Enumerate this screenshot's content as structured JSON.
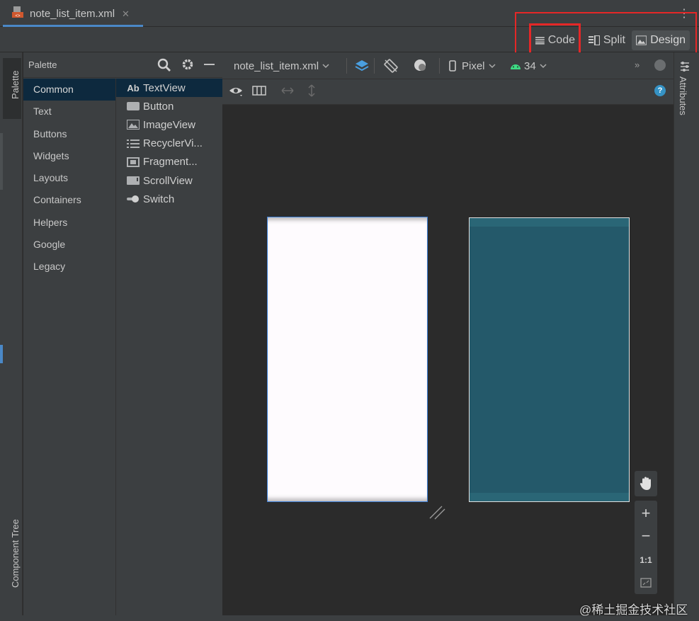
{
  "tab": {
    "file_name": "note_list_item.xml",
    "close": "✕"
  },
  "menu": {
    "more": "⋮"
  },
  "modes": {
    "code": "Code",
    "split": "Split",
    "design": "Design",
    "active": "Design"
  },
  "left_strip": {
    "palette": "Palette",
    "component_tree": "Component Tree"
  },
  "right_strip": {
    "attributes": "Attributes"
  },
  "palette": {
    "title": "Palette",
    "categories": [
      "Common",
      "Text",
      "Buttons",
      "Widgets",
      "Layouts",
      "Containers",
      "Helpers",
      "Google",
      "Legacy"
    ],
    "selected_category": "Common",
    "widgets": [
      {
        "label": "TextView",
        "icon": "ab-text-icon"
      },
      {
        "label": "Button",
        "icon": "button-icon"
      },
      {
        "label": "ImageView",
        "icon": "image-icon"
      },
      {
        "label": "RecyclerVi...",
        "icon": "list-icon"
      },
      {
        "label": "Fragment...",
        "icon": "fragment-icon"
      },
      {
        "label": "ScrollView",
        "icon": "scrollview-icon"
      },
      {
        "label": "Switch",
        "icon": "switch-icon"
      }
    ],
    "textview_prefix": "Ab"
  },
  "toolbar": {
    "file": "note_list_item.xml",
    "device": "Pixel",
    "api": "34",
    "overflow": "»"
  },
  "zoom": {
    "in": "+",
    "out": "−",
    "actual": "1:1"
  },
  "help": "?",
  "watermark": "@稀土掘金技术社区",
  "colors": {
    "accent": "#4a88c7",
    "highlight": "#e52727",
    "blueprint": "#24596a",
    "selection": "#0d293e"
  }
}
